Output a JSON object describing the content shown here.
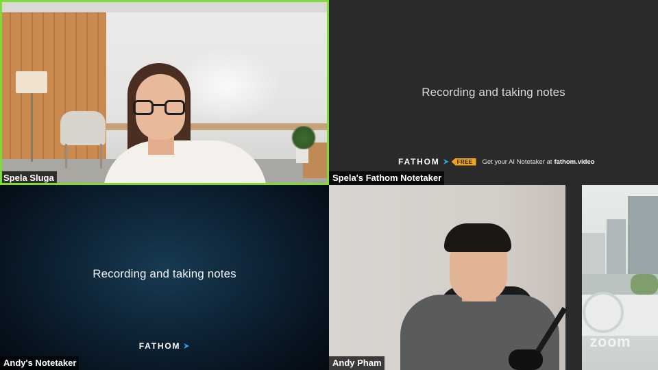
{
  "tiles": [
    {
      "id": "spela-video",
      "name": "Spela Sluga",
      "active_speaker": true,
      "active_color": "#7ddc3a"
    },
    {
      "id": "spela-notetaker",
      "name": "Spela's Fathom Notetaker",
      "message": "Recording and taking notes",
      "brand": "FATHOM",
      "badge": "FREE",
      "promo_text": "Get your AI Notetaker at",
      "promo_link": "fathom.video",
      "badge_color": "#f0a21b"
    },
    {
      "id": "andy-notetaker",
      "name": "Andy's Notetaker",
      "message": "Recording and taking notes",
      "brand": "FATHOM"
    },
    {
      "id": "andy-video",
      "name": "Andy Pham",
      "watermark": "zoom"
    }
  ],
  "icons": {
    "fathom_logo": "fathom-chevron-icon"
  },
  "colors": {
    "fathom_accent": "#2aa4f4"
  }
}
